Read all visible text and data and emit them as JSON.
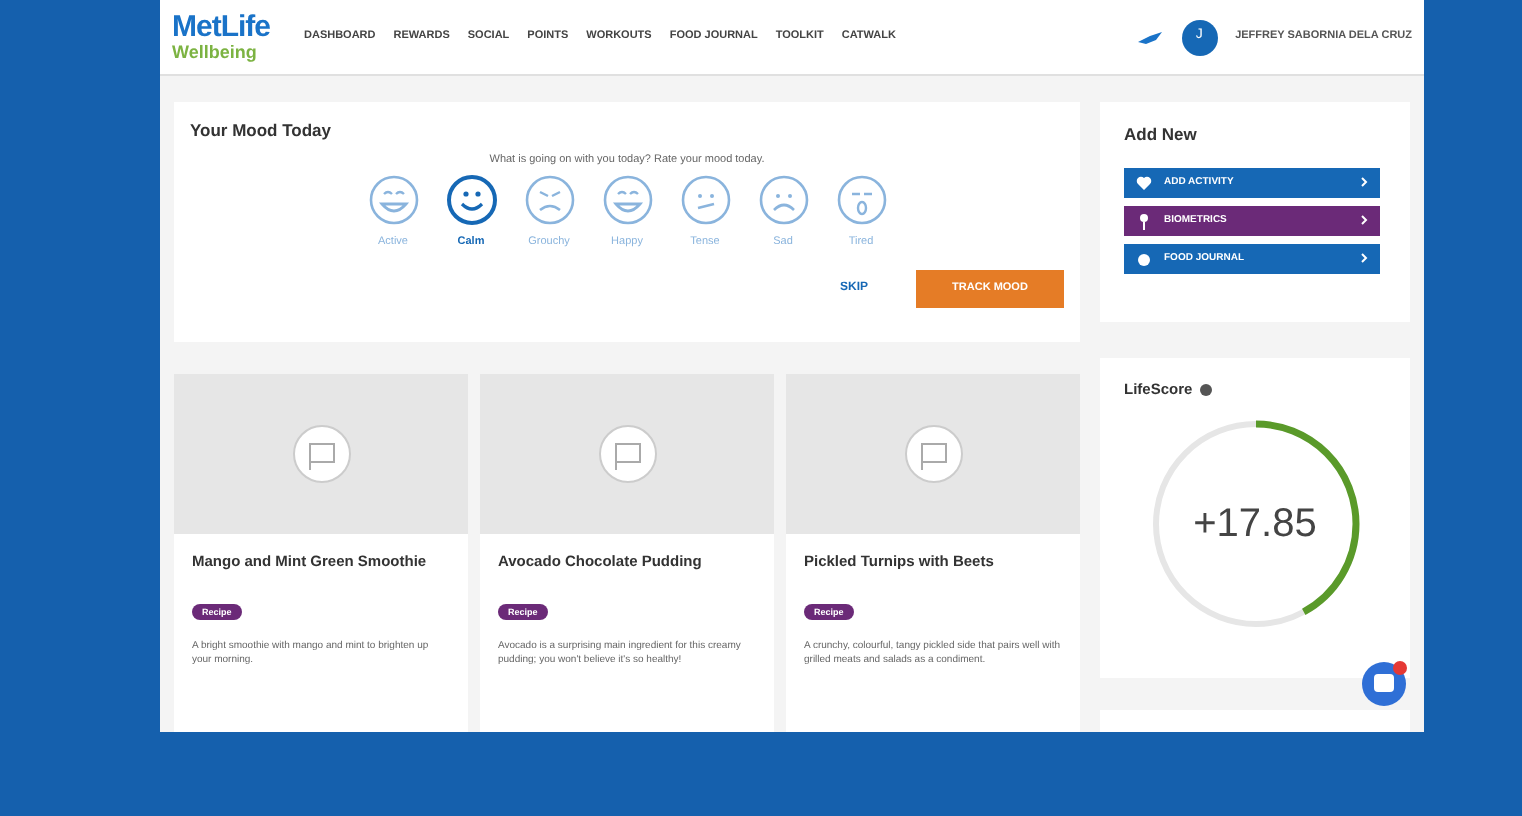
{
  "header": {
    "logo_top": "MetLife",
    "logo_bottom": "Wellbeing",
    "nav": [
      {
        "label": "DASHBOARD"
      },
      {
        "label": "REWARDS"
      },
      {
        "label": "SOCIAL"
      },
      {
        "label": "POINTS"
      },
      {
        "label": "WORKOUTS"
      },
      {
        "label": "FOOD JOURNAL"
      },
      {
        "label": "TOOLKIT"
      },
      {
        "label": "CATWALK"
      }
    ],
    "avatar_initial": "J",
    "user_name": "JEFFREY SABORNIA DELA CRUZ"
  },
  "mood": {
    "title": "Your Mood Today",
    "prompt": "What is going on with you today? Rate your mood today.",
    "options": [
      {
        "label": "Active",
        "selected": false
      },
      {
        "label": "Calm",
        "selected": true
      },
      {
        "label": "Grouchy",
        "selected": false
      },
      {
        "label": "Happy",
        "selected": false
      },
      {
        "label": "Tense",
        "selected": false
      },
      {
        "label": "Sad",
        "selected": false
      },
      {
        "label": "Tired",
        "selected": false
      }
    ],
    "skip": "SKIP",
    "submit": "TRACK MOOD"
  },
  "recipes": [
    {
      "title": "Mango and Mint Green Smoothie",
      "tag": "Recipe",
      "description": "A bright smoothie with mango and mint to brighten up your morning."
    },
    {
      "title": "Avocado Chocolate Pudding",
      "tag": "Recipe",
      "description": "Avocado is a surprising main ingredient for this creamy pudding; you won't believe it's so healthy!"
    },
    {
      "title": "Pickled Turnips with Beets",
      "tag": "Recipe",
      "description": "A crunchy, colourful, tangy pickled side that pairs well with grilled meats and salads as a condiment."
    }
  ],
  "add_new": {
    "title": "Add New",
    "items": [
      {
        "label": "ADD ACTIVITY",
        "color": "#1668b5"
      },
      {
        "label": "BIOMETRICS",
        "color": "#6b2a78"
      },
      {
        "label": "FOOD JOURNAL",
        "color": "#1668b5"
      }
    ]
  },
  "lifescore": {
    "title": "LifeScore",
    "value": "+17.85",
    "level": 0.42
  }
}
